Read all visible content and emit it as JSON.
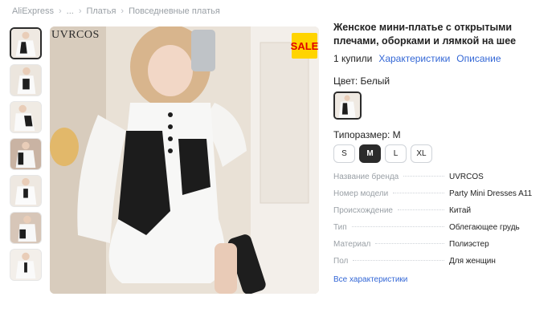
{
  "breadcrumb": {
    "items": [
      "AliExpress",
      "...",
      "Платья",
      "Повседневные платья"
    ],
    "separator": "›"
  },
  "thumbnails": {
    "count": 7,
    "active_index": 0
  },
  "main_image": {
    "watermark": "UVRCOS",
    "badge": "SALE",
    "badge_color": "#ffd400",
    "badge_text_color": "#e00000"
  },
  "product": {
    "title": "Женское мини-платье с открытыми плечами, оборками и лямкой на шее",
    "sold": "1 купили",
    "characteristics_link": "Характеристики",
    "description_link": "Описание",
    "color_label": "Цвет: Белый",
    "size_label": "Типоразмер: M",
    "sizes": [
      "S",
      "M",
      "L",
      "XL"
    ],
    "selected_size": "M"
  },
  "specs": [
    {
      "key": "Название бренда",
      "value": "UVRCOS"
    },
    {
      "key": "Номер модели",
      "value": "Party Mini Dresses A11"
    },
    {
      "key": "Происхождение",
      "value": "Китай"
    },
    {
      "key": "Тип",
      "value": "Облегающее грудь"
    },
    {
      "key": "Материал",
      "value": "Полиэстер"
    },
    {
      "key": "Пол",
      "value": "Для женщин"
    }
  ],
  "all_specs_link": "Все характеристики",
  "colors": {
    "link": "#3367d6",
    "muted": "#9aa0a6",
    "selected": "#2b2b2b"
  }
}
